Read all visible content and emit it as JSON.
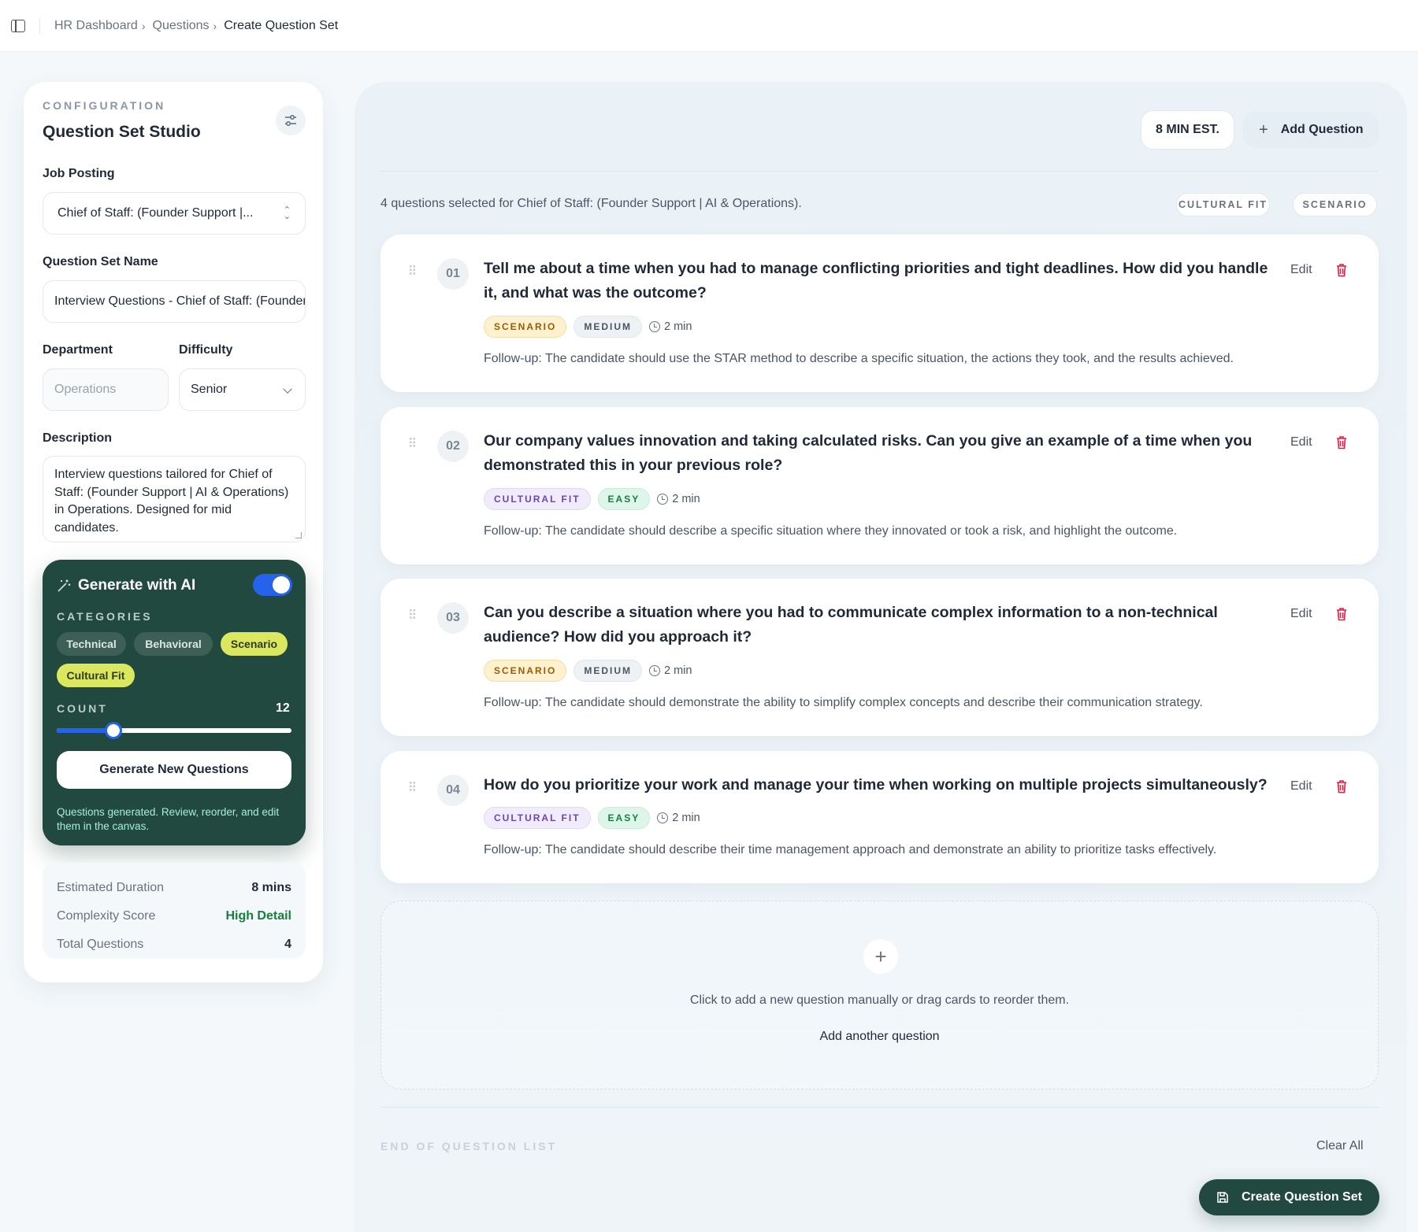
{
  "breadcrumb": [
    "HR Dashboard",
    "Questions",
    "Create Question Set"
  ],
  "config": {
    "eyebrow": "CONFIGURATION",
    "title": "Question Set Studio",
    "job_posting_label": "Job Posting",
    "job_posting_value": "Chief of Staff: (Founder Support |...",
    "set_name_label": "Question Set Name",
    "set_name_value": "Interview Questions - Chief of Staff:  (Founder Support | AI & Operations)",
    "department_label": "Department",
    "department_placeholder": "Operations",
    "difficulty_label": "Difficulty",
    "difficulty_value": "Senior",
    "description_label": "Description",
    "description_value": "Interview questions tailored for Chief of Staff:  (Founder Support | AI & Operations) in Operations. Designed for mid candidates."
  },
  "ai": {
    "title": "Generate with AI",
    "toggle_on": true,
    "categories_label": "CATEGORIES",
    "categories": [
      {
        "label": "Technical",
        "active": false
      },
      {
        "label": "Behavioral",
        "active": false
      },
      {
        "label": "Scenario",
        "active": true
      },
      {
        "label": "Cultural Fit",
        "active": true
      }
    ],
    "count_label": "COUNT",
    "count_value": "12",
    "slider_fraction": 0.24,
    "generate_label": "Generate New Questions",
    "note": "Questions generated. Review, reorder, and edit them in the canvas."
  },
  "stats": {
    "duration_label": "Estimated Duration",
    "duration_value": "8 mins",
    "complexity_label": "Complexity Score",
    "complexity_value": "High Detail",
    "total_label": "Total Questions",
    "total_value": "4"
  },
  "main": {
    "estimate": "8 MIN EST.",
    "add_question": "Add Question",
    "summary": "4 questions selected for Chief of Staff: (Founder Support | AI & Operations).",
    "tags": [
      "CULTURAL FIT",
      "SCENARIO"
    ],
    "questions": [
      {
        "num": "01",
        "text": "Tell me about a time when you had to manage conflicting priorities and tight deadlines. How did you handle it, and what was the outcome?",
        "category": "SCENARIO",
        "difficulty": "MEDIUM",
        "time": "2 min",
        "followup": "Follow-up: The candidate should use the STAR method to describe a specific situation, the actions they took, and the results achieved."
      },
      {
        "num": "02",
        "text": "Our company values innovation and taking calculated risks. Can you give an example of a time when you demonstrated this in your previous role?",
        "category": "CULTURAL FIT",
        "difficulty": "EASY",
        "time": "2 min",
        "followup": "Follow-up: The candidate should describe a specific situation where they innovated or took a risk, and highlight the outcome."
      },
      {
        "num": "03",
        "text": "Can you describe a situation where you had to communicate complex information to a non-technical audience? How did you approach it?",
        "category": "SCENARIO",
        "difficulty": "MEDIUM",
        "time": "2 min",
        "followup": "Follow-up: The candidate should demonstrate the ability to simplify complex concepts and describe their communication strategy."
      },
      {
        "num": "04",
        "text": "How do you prioritize your work and manage your time when working on multiple projects simultaneously?",
        "category": "CULTURAL FIT",
        "difficulty": "EASY",
        "time": "2 min",
        "followup": "Follow-up: The candidate should describe their time management approach and demonstrate an ability to prioritize tasks effectively."
      }
    ],
    "edit_label": "Edit",
    "add_zone_text": "Click to add a new question manually or drag cards to reorder them.",
    "add_zone_link": "Add another question",
    "end_label": "END OF QUESTION LIST",
    "clear_all": "Clear All",
    "create_label": "Create Question Set"
  },
  "colors": {
    "accent_dark_green": "#22493f",
    "toggle_blue": "#2563eb",
    "chip_active": "#dbe85f"
  }
}
